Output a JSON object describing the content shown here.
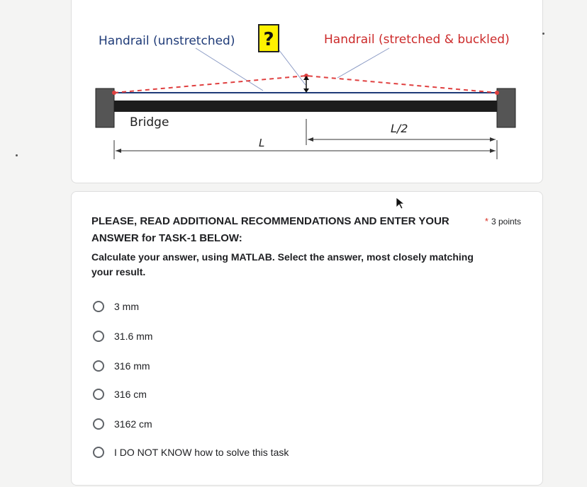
{
  "figure": {
    "label_unstretched": "Handrail (unstretched)",
    "label_question": "?",
    "label_stretched": "Handrail (stretched & buckled)",
    "label_bridge": "Bridge",
    "label_L": "L",
    "label_L_half": "L/2",
    "colors": {
      "unstretched": "#1f3b78",
      "stretched": "#e04040",
      "question_bg": "#fff200",
      "bridge": "#1c1c1c",
      "pier": "#555555"
    }
  },
  "question": {
    "title": "PLEASE, READ ADDITIONAL RECOMMENDATIONS AND ENTER YOUR ANSWER for TASK-1 BELOW:",
    "required_mark": "*",
    "points": "3 points",
    "description": "Calculate your answer, using MATLAB. Select the answer, most closely matching your result.",
    "options": [
      {
        "label": "3 mm"
      },
      {
        "label": "31.6 mm"
      },
      {
        "label": "316 mm"
      },
      {
        "label": "316 cm"
      },
      {
        "label": "3162 cm"
      },
      {
        "label": "I DO NOT KNOW how to solve this task"
      }
    ]
  },
  "icons": {
    "cursor": "mouse-pointer-icon",
    "radio": "radio-circle-icon"
  }
}
